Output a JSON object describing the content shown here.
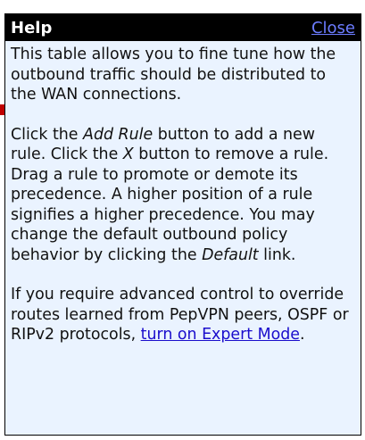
{
  "help": {
    "title": "Help",
    "close_label": "Close",
    "paragraph1": "This table allows you to fine tune how the outbound traffic should be distributed to the WAN connections.",
    "paragraph2": {
      "part1": "Click the ",
      "add_rule": "Add Rule",
      "part2": " button to add a new rule. Click the ",
      "x": "X",
      "part3": " button to remove a rule. Drag a rule to promote or demote its precedence. A higher position of a rule signifies a higher precedence. You may change the default outbound policy behavior by clicking the ",
      "default": "Default",
      "part4": " link."
    },
    "paragraph3": {
      "text": "If you require advanced control to override routes learned from PepVPN peers, OSPF or RIPv2 protocols, ",
      "expert_link": "turn on Expert Mode",
      "end": "."
    }
  },
  "colors": {
    "header_bg": "#000000",
    "panel_bg": "#eaf3ff",
    "close_link": "#6c7cff",
    "expert_link": "#1a0dcc"
  }
}
